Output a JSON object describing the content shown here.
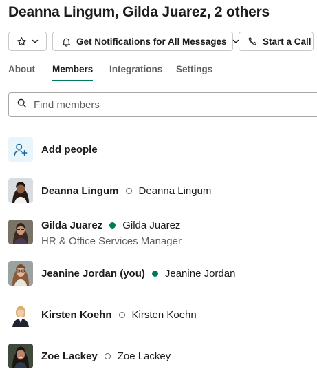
{
  "header": {
    "title": "Deanna Lingum, Gilda Juarez, 2 others",
    "notifications_label": "Get Notifications for All Messages",
    "call_label": "Start a Call"
  },
  "tabs": [
    {
      "label": "About",
      "active": false
    },
    {
      "label": "Members",
      "active": true
    },
    {
      "label": "Integrations",
      "active": false
    },
    {
      "label": "Settings",
      "active": false
    }
  ],
  "search": {
    "placeholder": "Find members",
    "value": ""
  },
  "add_people": {
    "label": "Add people"
  },
  "members": [
    {
      "name": "Deanna Lingum",
      "display_name": "Deanna Lingum",
      "status": "away",
      "title": ""
    },
    {
      "name": "Gilda Juarez",
      "display_name": "Gilda Juarez",
      "status": "active",
      "title": "HR & Office Services Manager"
    },
    {
      "name": "Jeanine Jordan (you)",
      "display_name": "Jeanine Jordan",
      "status": "active",
      "title": ""
    },
    {
      "name": "Kirsten Koehn",
      "display_name": "Kirsten Koehn",
      "status": "away",
      "title": ""
    },
    {
      "name": "Zoe Lackey",
      "display_name": "Zoe Lackey",
      "status": "away",
      "title": ""
    }
  ],
  "colors": {
    "accent": "#007a5a",
    "presence_active": "#007a5a",
    "presence_away": "#616061",
    "add_icon_bg": "#e8f5fa",
    "add_icon": "#1264a3"
  },
  "icons": {
    "star": "star-icon",
    "bell": "bell-icon",
    "phone": "phone-icon",
    "search": "search-icon",
    "add_person": "add-person-icon"
  }
}
